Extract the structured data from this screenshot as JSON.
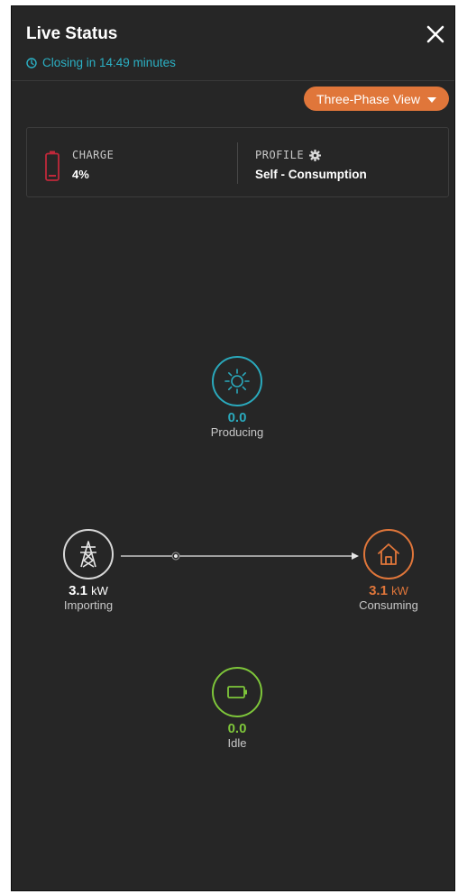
{
  "header": {
    "title": "Live Status",
    "closing_text": "Closing in 14:49 minutes",
    "close_icon": "close-icon",
    "clock_icon": "clock-icon"
  },
  "view_button": {
    "label": "Three-Phase View",
    "icon": "caret-down-icon"
  },
  "status_card": {
    "charge": {
      "label": "CHARGE",
      "value": "4%",
      "icon": "battery-icon"
    },
    "profile": {
      "label": "PROFILE",
      "value": "Self - Consumption",
      "icon": "gear-icon"
    }
  },
  "flow": {
    "solar": {
      "value": "0.0",
      "label": "Producing",
      "icon": "sun-icon"
    },
    "grid": {
      "value": "3.1",
      "unit": "kW",
      "label": "Importing",
      "icon": "power-tower-icon"
    },
    "home": {
      "value": "3.1",
      "unit": "kW",
      "label": "Consuming",
      "icon": "house-icon"
    },
    "battery": {
      "value": "0.0",
      "label": "Idle",
      "icon": "battery-icon"
    }
  },
  "colors": {
    "background": "#262626",
    "accent_orange": "#e0763a",
    "solar_teal": "#2aa9bc",
    "battery_green": "#7ec63a",
    "charge_red": "#c0283a"
  }
}
